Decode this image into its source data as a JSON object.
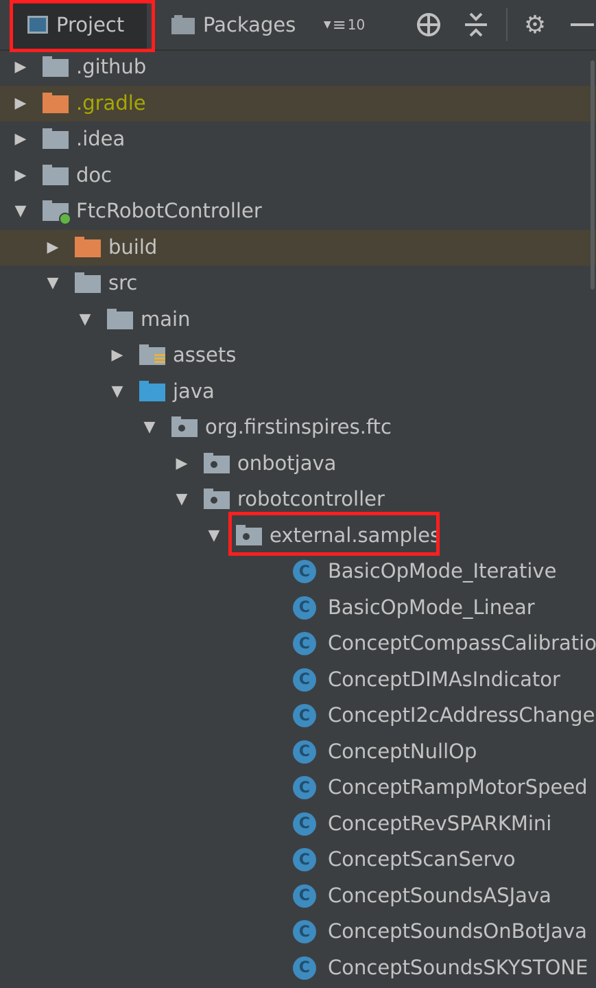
{
  "toolbar": {
    "tab_project": "Project",
    "tab_packages": "Packages",
    "count": "10",
    "icons": [
      "locate-icon",
      "collapse-all-icon",
      "gear-icon",
      "hide-icon"
    ]
  },
  "tree": [
    {
      "label": ".github",
      "depth": 0,
      "expanded": false,
      "icon": "folder",
      "excluded": false
    },
    {
      "label": ".gradle",
      "depth": 0,
      "expanded": false,
      "icon": "folder-orange",
      "excluded": true
    },
    {
      "label": ".idea",
      "depth": 0,
      "expanded": false,
      "icon": "folder",
      "excluded": false
    },
    {
      "label": "doc",
      "depth": 0,
      "expanded": false,
      "icon": "folder",
      "excluded": false
    },
    {
      "label": "FtcRobotController",
      "depth": 0,
      "expanded": true,
      "icon": "module",
      "excluded": false
    },
    {
      "label": "build",
      "depth": 1,
      "expanded": false,
      "icon": "folder-orange",
      "excluded": true
    },
    {
      "label": "src",
      "depth": 1,
      "expanded": true,
      "icon": "folder",
      "excluded": false
    },
    {
      "label": "main",
      "depth": 2,
      "expanded": true,
      "icon": "folder",
      "excluded": false
    },
    {
      "label": "assets",
      "depth": 3,
      "expanded": false,
      "icon": "resources",
      "excluded": false
    },
    {
      "label": "java",
      "depth": 3,
      "expanded": true,
      "icon": "folder-blue",
      "excluded": false
    },
    {
      "label": "org.firstinspires.ftc",
      "depth": 4,
      "expanded": true,
      "icon": "package",
      "excluded": false
    },
    {
      "label": "onbotjava",
      "depth": 5,
      "expanded": false,
      "icon": "package",
      "excluded": false
    },
    {
      "label": "robotcontroller",
      "depth": 5,
      "expanded": true,
      "icon": "package",
      "excluded": false
    },
    {
      "label": "external.samples",
      "depth": 6,
      "expanded": true,
      "icon": "package",
      "excluded": false,
      "highlighted": true
    },
    {
      "label": "BasicOpMode_Iterative",
      "depth": 7,
      "icon": "class"
    },
    {
      "label": "BasicOpMode_Linear",
      "depth": 7,
      "icon": "class"
    },
    {
      "label": "ConceptCompassCalibration",
      "depth": 7,
      "icon": "class"
    },
    {
      "label": "ConceptDIMAsIndicator",
      "depth": 7,
      "icon": "class"
    },
    {
      "label": "ConceptI2cAddressChange",
      "depth": 7,
      "icon": "class"
    },
    {
      "label": "ConceptNullOp",
      "depth": 7,
      "icon": "class"
    },
    {
      "label": "ConceptRampMotorSpeed",
      "depth": 7,
      "icon": "class"
    },
    {
      "label": "ConceptRevSPARKMini",
      "depth": 7,
      "icon": "class"
    },
    {
      "label": "ConceptScanServo",
      "depth": 7,
      "icon": "class"
    },
    {
      "label": "ConceptSoundsASJava",
      "depth": 7,
      "icon": "class"
    },
    {
      "label": "ConceptSoundsOnBotJava",
      "depth": 7,
      "icon": "class"
    },
    {
      "label": "ConceptSoundsSKYSTONE",
      "depth": 7,
      "icon": "class"
    }
  ],
  "class_icon_letter": "C",
  "colors": {
    "background": "#3c3f41",
    "excluded_row": "#4a4436",
    "highlight_box": "#ff1f1f",
    "class_icon": "#3e8bbf",
    "excluded_label": "#a8a800"
  }
}
